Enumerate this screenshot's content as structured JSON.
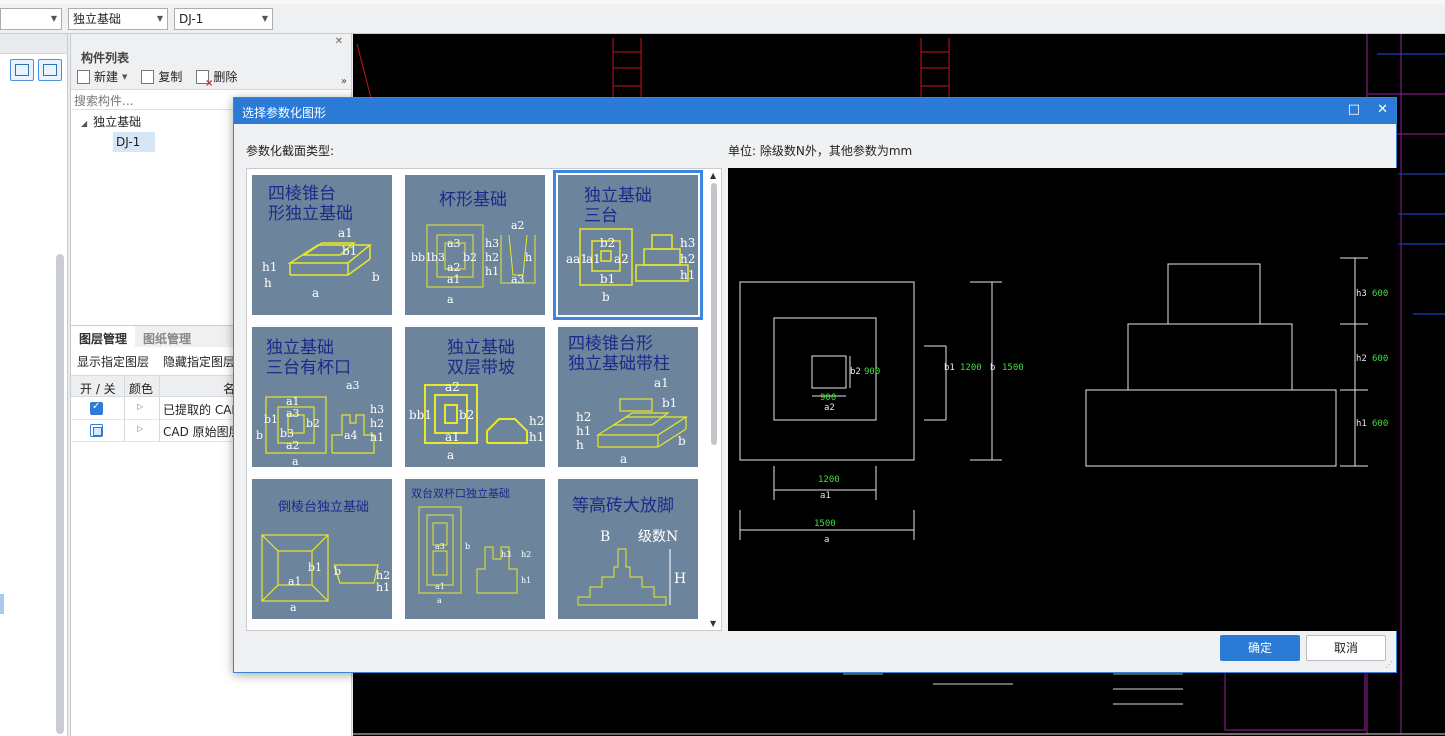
{
  "toolbar": {
    "combo_type": "独立基础",
    "combo_name": "DJ-1"
  },
  "component_panel": {
    "title": "构件列表",
    "new_label": "新建",
    "copy_label": "复制",
    "delete_label": "删除",
    "search_placeholder": "搜索构件...",
    "tree_root": "独立基础",
    "tree_child": "DJ-1"
  },
  "layer_panel": {
    "tab_layers": "图层管理",
    "tab_drawings": "图纸管理",
    "show_specified": "显示指定图层",
    "hide_specified": "隐藏指定图层",
    "col_onoff": "开 / 关",
    "col_color": "颜色",
    "col_name": "名",
    "rows": [
      {
        "name": "已提取的 CAD",
        "checked": true
      },
      {
        "name": "CAD 原始图层",
        "checked": false
      }
    ]
  },
  "dialog": {
    "title": "选择参数化图形",
    "section_label": "参数化截面类型:",
    "unit_label": "单位:   除级数N外，其他参数为mm",
    "ok_label": "确定",
    "cancel_label": "取消",
    "shapes": [
      {
        "title1": "四棱锥台",
        "title2": "形独立基础"
      },
      {
        "title1": "杯形基础",
        "title2": ""
      },
      {
        "title1": "独立基础",
        "title2": "三台"
      },
      {
        "title1": "独立基础",
        "title2": "三台有杯口"
      },
      {
        "title1": "独立基础",
        "title2": "双层带坡"
      },
      {
        "title1": "四棱锥台形",
        "title2": "独立基础带柱"
      },
      {
        "title1": "倒棱台独立基础",
        "title2": ""
      },
      {
        "title1": "双台双杯口独立基础",
        "title2": ""
      },
      {
        "title1": "等高砖大放脚",
        "title2": ""
      }
    ],
    "shape_labels": {
      "s1": [
        "a1",
        "b1",
        "h1",
        "h",
        "a",
        "b"
      ],
      "s2": [
        "a2",
        "a3",
        "b3",
        "b2",
        "a2",
        "a1",
        "h3",
        "h2",
        "h1",
        "h",
        "a3",
        "bb1",
        "a"
      ],
      "s3": [
        "b2",
        "a1",
        "a2",
        "b1",
        "h3",
        "h2",
        "h1",
        "aa1",
        "b"
      ],
      "s4": [
        "a1",
        "a3",
        "b1",
        "b3",
        "b2",
        "a2",
        "a",
        "a3",
        "h3",
        "h2",
        "h1",
        "a4",
        "b"
      ],
      "s5": [
        "a2",
        "b2",
        "bb1",
        "a1",
        "a",
        "h2",
        "h1"
      ],
      "s6": [
        "a1",
        "b1",
        "h2",
        "h1",
        "h",
        "b",
        "a"
      ],
      "s7": [
        "b1",
        "a1",
        "b",
        "h2",
        "h1",
        "a"
      ],
      "s8": [
        "a3",
        "h3",
        "h2",
        "a1",
        "h1",
        "a",
        "b"
      ],
      "s9": [
        "B",
        "级数N",
        "H"
      ]
    },
    "preview_labels": {
      "plan_a2_val": "900",
      "plan_a2": "a2",
      "plan_b2_val": "900",
      "plan_b2": "b2",
      "plan_b1": "b1",
      "plan_b1_val": "1200",
      "plan_b": "b",
      "plan_b_val": "1500",
      "plan_a1_val": "1200",
      "plan_a1": "a1",
      "plan_a_val": "1500",
      "plan_a": "a",
      "elev_h3": "h3",
      "elev_h3_val": "600",
      "elev_h2": "h2",
      "elev_h2_val": "600",
      "elev_h1": "h1",
      "elev_h1_val": "600"
    },
    "colors": {
      "accent": "#2b7ad6",
      "thumb_bg": "#6c859c",
      "thumb_line": "#e8e82a",
      "thumb_title": "#1d2a8a",
      "dim_value": "#3de03d"
    }
  }
}
